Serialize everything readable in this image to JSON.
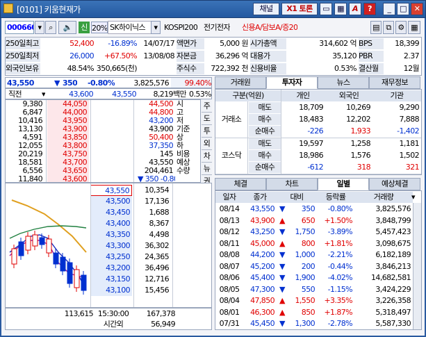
{
  "window": {
    "title": "[0101] 키움현재가",
    "btn_channel": "채널",
    "btn_x1": "X1 토론",
    "btn_a": "A",
    "btn_help": "?",
    "btn_min": "_",
    "btn_max": "□",
    "btn_close": "✕"
  },
  "toolbar": {
    "code": "000660",
    "stock_name": "SK하이닉스",
    "market_badge": "신",
    "margin": "20%",
    "index": "KOSPI200",
    "sector": "전기전자",
    "credit": "신용A/담보A/증20"
  },
  "info_rows": [
    {
      "l1": "250일최고",
      "v1": "52,400",
      "p1": "-16.89%",
      "d1": "14/07/17",
      "l2": "액면가",
      "v2": "5,000 원",
      "l3": "시가총액",
      "v3": "314,602 억",
      "l4": "BPS",
      "v4": "18,399"
    },
    {
      "l1": "250일최저",
      "v1": "26,000",
      "p1": "+67.50%",
      "d1": "13/08/08",
      "l2": "자본금",
      "v2": "36,296 억",
      "l3": "대용가",
      "v3": "35,120",
      "l4": "PBR",
      "v4": "2.37"
    },
    {
      "l1": "외국인보유",
      "v1": "48.54%",
      "p1": "350,665(천)",
      "d1": "",
      "l2": "주식수",
      "v2": "722,392 천",
      "l3": "신용비율",
      "v3": "0.53%",
      "l4": "결산월",
      "v4": "12월"
    }
  ],
  "quote": {
    "price": "43,550",
    "change": "350",
    "rate": "-0.80%",
    "volume": "3,825,576",
    "ratio": "99.40%",
    "direct": "직전",
    "prev_price": "43,600",
    "cur_price": "43,550",
    "amount": "8,219백만",
    "amount_ratio": "0.53%"
  },
  "ask_rows": [
    {
      "qty": "9,380",
      "price": "44,050"
    },
    {
      "qty": "6,847",
      "price": "44,000"
    },
    {
      "qty": "10,416",
      "price": "43,950"
    },
    {
      "qty": "13,130",
      "price": "43,900"
    },
    {
      "qty": "4,591",
      "price": "43,850"
    },
    {
      "qty": "12,055",
      "price": "43,800"
    },
    {
      "qty": "20,219",
      "price": "43,750"
    },
    {
      "qty": "18,581",
      "price": "43,700"
    },
    {
      "qty": "6,556",
      "price": "43,650"
    },
    {
      "qty": "11,840",
      "price": "43,600"
    }
  ],
  "mid_info": [
    {
      "label": "시",
      "value": "44,500"
    },
    {
      "label": "고",
      "value": "44,800"
    },
    {
      "label": "저",
      "value": "43,200"
    },
    {
      "label": "기준",
      "value": "43,900"
    },
    {
      "label": "상",
      "value": "50,400"
    },
    {
      "label": "하",
      "value": "37,350"
    },
    {
      "label": "비용",
      "value": "145"
    },
    {
      "label": "예상",
      "value": "43,550"
    },
    {
      "label": "수량",
      "value": "204,461"
    },
    {
      "label": "",
      "value": "▼ 350  -0.80%"
    }
  ],
  "side_tabs": [
    "주",
    "도",
    "투",
    "외",
    "차",
    "뉴",
    "권",
    "기"
  ],
  "bid_rows": [
    {
      "price": "43,550",
      "qty": "10,354"
    },
    {
      "price": "43,500",
      "qty": "17,136"
    },
    {
      "price": "43,450",
      "qty": "1,688"
    },
    {
      "price": "43,400",
      "qty": "8,367"
    },
    {
      "price": "43,350",
      "qty": "4,498"
    },
    {
      "price": "43,300",
      "qty": "36,302"
    },
    {
      "price": "43,250",
      "qty": "24,365"
    },
    {
      "price": "43,200",
      "qty": "36,496"
    },
    {
      "price": "43,150",
      "qty": "12,716"
    },
    {
      "price": "43,100",
      "qty": "15,456"
    }
  ],
  "totals": {
    "ask_total": "113,615",
    "time": "15:30:00",
    "bid_total": "167,378",
    "after_label": "시간외",
    "after_qty": "56,949"
  },
  "investor_tabs": [
    "거래원",
    "투자자",
    "뉴스",
    "재무정보"
  ],
  "investor_header": [
    "구분(억원)",
    "개인",
    "외국인",
    "기관"
  ],
  "investor_groups": [
    {
      "name": "거래소",
      "rows": [
        {
          "k": "매도",
          "a": "18,709",
          "b": "10,269",
          "c": "9,290"
        },
        {
          "k": "매수",
          "a": "18,483",
          "b": "12,202",
          "c": "7,888"
        },
        {
          "k": "순매수",
          "a": "-226",
          "b": "1,933",
          "c": "-1,402"
        }
      ]
    },
    {
      "name": "코스닥",
      "rows": [
        {
          "k": "매도",
          "a": "19,597",
          "b": "1,258",
          "c": "1,181"
        },
        {
          "k": "매수",
          "a": "18,986",
          "b": "1,576",
          "c": "1,502"
        },
        {
          "k": "순매수",
          "a": "-612",
          "b": "318",
          "c": "321"
        }
      ]
    }
  ],
  "daily_tabs": [
    "체결",
    "차트",
    "일별",
    "예상체결"
  ],
  "daily_header": [
    "일자",
    "종가",
    "대비",
    "등락률",
    "거래량"
  ],
  "daily_rows": [
    {
      "date": "08/14",
      "close": "43,550",
      "dir": "down",
      "diff": "350",
      "rate": "-0.80%",
      "vol": "3,825,576"
    },
    {
      "date": "08/13",
      "close": "43,900",
      "dir": "up",
      "diff": "650",
      "rate": "+1.50%",
      "vol": "3,848,799"
    },
    {
      "date": "08/12",
      "close": "43,250",
      "dir": "down",
      "diff": "1,750",
      "rate": "-3.89%",
      "vol": "5,457,423"
    },
    {
      "date": "08/11",
      "close": "45,000",
      "dir": "up",
      "diff": "800",
      "rate": "+1.81%",
      "vol": "3,098,675"
    },
    {
      "date": "08/08",
      "close": "44,200",
      "dir": "down",
      "diff": "1,000",
      "rate": "-2.21%",
      "vol": "6,182,189"
    },
    {
      "date": "08/07",
      "close": "45,200",
      "dir": "down",
      "diff": "200",
      "rate": "-0.44%",
      "vol": "3,846,213"
    },
    {
      "date": "08/06",
      "close": "45,400",
      "dir": "down",
      "diff": "1,900",
      "rate": "-4.02%",
      "vol": "14,682,581"
    },
    {
      "date": "08/05",
      "close": "47,300",
      "dir": "down",
      "diff": "550",
      "rate": "-1.15%",
      "vol": "3,424,229"
    },
    {
      "date": "08/04",
      "close": "47,850",
      "dir": "up",
      "diff": "1,550",
      "rate": "+3.35%",
      "vol": "3,226,358"
    },
    {
      "date": "08/01",
      "close": "46,300",
      "dir": "up",
      "diff": "850",
      "rate": "+1.87%",
      "vol": "5,318,497"
    },
    {
      "date": "07/31",
      "close": "45,450",
      "dir": "down",
      "diff": "1,300",
      "rate": "-2.78%",
      "vol": "5,587,330"
    }
  ],
  "colors": {
    "up": "#e00000",
    "down": "#0030d0",
    "title_bar": "#2a5aa0"
  }
}
